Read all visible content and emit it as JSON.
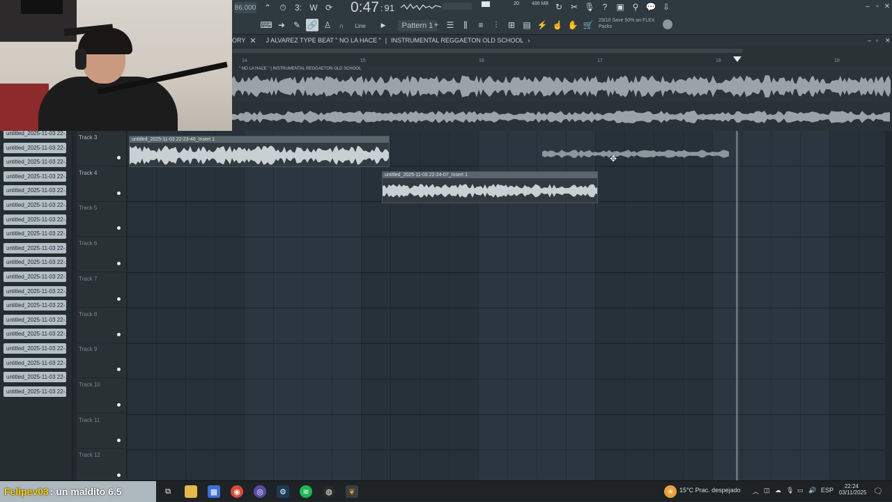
{
  "toolbar": {
    "tempo": "86.000",
    "time_main": "0:47",
    "time_sub": "91",
    "snap": "Line",
    "pattern": "Pattern 1",
    "memory": "486 MB",
    "cpu": "20",
    "promo": "23/10  Save 50% on FLEX Packs"
  },
  "playlist_title": {
    "left": "ORY",
    "song": "J ALVAREZ TYPE BEAT \" NO LA HACE \"",
    "sep": "|",
    "subtitle": "INSTRUMENTAL REGGAETON OLD SCHOOL",
    "arrow": "›"
  },
  "ruler": [
    "14",
    "15",
    "16",
    "17",
    "18",
    "19"
  ],
  "top_track_label": "\" NO LA HACE \"  |  INSTRUMENTAL REGGAETON OLD SCHOOL",
  "browser": {
    "items": [
      "untitled_2025-11-03 22-...",
      "untitled_2025-11-03 22-...",
      "untitled_2025-11-03 22-...",
      "untitled_2025-11-03 22-...",
      "untitled_2025-11-03 22-...",
      "untitled_2025-11-03 22-...",
      "untitled_2025-11-03 22-...",
      "untitled_2025-11-03 22-...",
      "untitled_2025-11-03 22-...",
      "untitled_2025-11-03 22-...",
      "untitled_2025-11-03 22-...",
      "untitled_2025-11-03 22-...",
      "untitled_2025-11-03 22-...",
      "untitled_2025-11-03 22-...",
      "untitled_2025-11-03 22-...",
      "untitled_2025-11-03 22-...",
      "untitled_2025-11-03 22-...",
      "untitled_2025-11-03 22-...",
      "untitled_2025-11-03 22-..."
    ]
  },
  "tracks": [
    "Track 3",
    "Track 4",
    "Track 5",
    "Track 6",
    "Track 7",
    "Track 8",
    "Track 9",
    "Track 10",
    "Track 11",
    "Track 12"
  ],
  "clips": {
    "clip1": "untitled_2025-11-03 22-23-46_Insert 1",
    "clip2": "untitled_2025-11-03 22-24-07_Insert 1"
  },
  "taskbar": {
    "stream_user": "Felipev03",
    "stream_msg": ": un maldito 6.5",
    "weather": "15°C  Prac. despejado",
    "lang": "ESP",
    "time": "22:24",
    "date": "03/11/2025"
  },
  "colors": {
    "accent": "#ffd000",
    "wave": "#9aa3a8"
  }
}
